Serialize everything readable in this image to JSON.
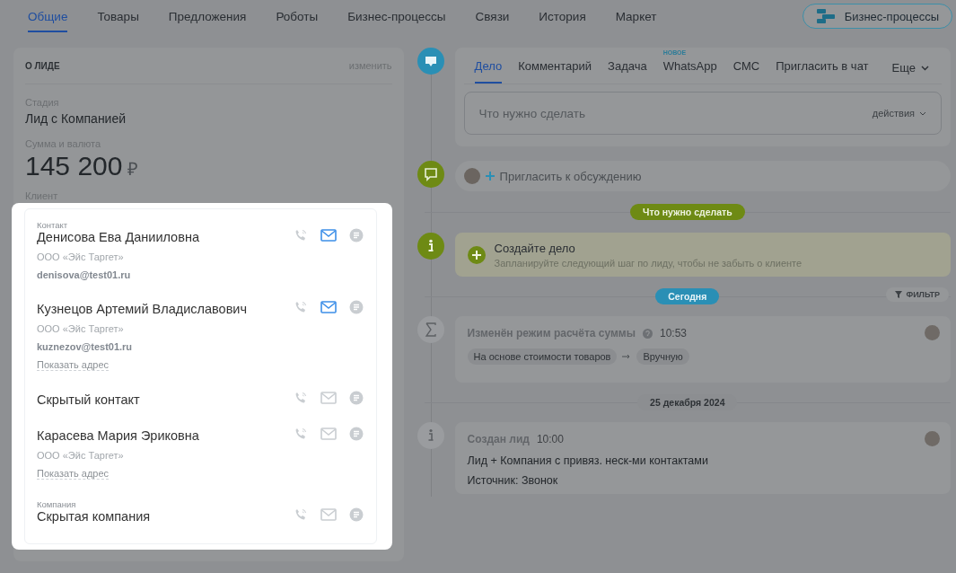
{
  "top_tabs": [
    {
      "label": "Общие",
      "selected": true
    },
    {
      "label": "Товары",
      "selected": false
    },
    {
      "label": "Предложения",
      "selected": false
    },
    {
      "label": "Роботы",
      "selected": false
    },
    {
      "label": "Бизнес-процессы",
      "selected": false
    },
    {
      "label": "Связи",
      "selected": false
    },
    {
      "label": "История",
      "selected": false
    },
    {
      "label": "Маркет",
      "selected": false
    }
  ],
  "bp_button": {
    "label": "Бизнес-процессы"
  },
  "lead_panel": {
    "title": "О ЛИДЕ",
    "edit_link": "изменить",
    "fields": [
      {
        "kind": "text",
        "label": "Стадия",
        "value": "Лид с Компанией"
      },
      {
        "kind": "amount",
        "label": "Сумма и валюта",
        "value": "145 200",
        "currency": "₽"
      }
    ],
    "client_label": "Клиент"
  },
  "client_card": {
    "entries": [
      {
        "caption": "Контакт",
        "name": "Денисова Ева Данииловна",
        "company": "ООО «Эйс Таргет»",
        "email": "denisova@test01.ru",
        "email_active": true
      },
      {
        "name": "Кузнецов Артемий Владиславович",
        "company": "ООО «Эйс Таргет»",
        "email": "kuznezov@test01.ru",
        "address_link": "Показать адрес",
        "email_active": true
      },
      {
        "name": "Скрытый контакт",
        "email_active": false
      },
      {
        "name": "Карасева Мария Эриковна",
        "company": "ООО «Эйс Таргет»",
        "address_link": "Показать адрес",
        "email_active": false
      },
      {
        "caption": "Компания",
        "name": "Скрытая компания",
        "email_active": false
      }
    ]
  },
  "composer": {
    "tabs": [
      {
        "label": "Дело",
        "selected": true
      },
      {
        "label": "Комментарий",
        "selected": false
      },
      {
        "label": "Задача",
        "selected": false
      },
      {
        "label": "WhatsApp",
        "selected": false,
        "badge": "НОВОЕ"
      },
      {
        "label": "СМС",
        "selected": false
      },
      {
        "label": "Пригласить в чат",
        "selected": false
      }
    ],
    "more": "Еще",
    "placeholder": "Что нужно сделать",
    "actions": "действия"
  },
  "invite": {
    "label": "Пригласить к обсуждению"
  },
  "todo_divider": "Что нужно сделать",
  "create_task": {
    "title": "Создайте дело",
    "hint": "Запланируйте следующий шаг по лиду, чтобы не забыть о клиенте"
  },
  "feed": [
    {
      "kind": "today",
      "label": "Сегодня",
      "filter": "ФИЛЬТР"
    },
    {
      "kind": "change",
      "title": "Изменён режим расчёта суммы",
      "time": "10:53",
      "from": "На основе стоимости товаров",
      "to": "Вручную"
    },
    {
      "kind": "date",
      "label": "25 декабря 2024"
    },
    {
      "kind": "created",
      "title": "Создан лид",
      "time": "10:00",
      "lines": [
        "Лид + Компания с привяз. неск-ми контактами",
        "Источник: Звонок"
      ]
    }
  ]
}
